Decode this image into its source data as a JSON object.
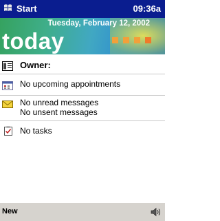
{
  "titlebar": {
    "start_label": "Start",
    "clock": "09:36a",
    "start_icon": "windows-flag-icon"
  },
  "banner": {
    "date": "Tuesday, February 12, 2002",
    "title": "today"
  },
  "items": {
    "owner": {
      "label": "Owner:",
      "icon": "owner-card-icon"
    },
    "appointments": {
      "label": "No upcoming appointments",
      "icon": "calendar-icon"
    },
    "messages": {
      "line1": "No unread messages",
      "line2": "No unsent messages",
      "icon": "envelope-icon"
    },
    "tasks": {
      "label": "No tasks",
      "icon": "task-checkbox-icon"
    }
  },
  "cmdbar": {
    "new_label": "New",
    "speaker_icon": "speaker-icon"
  },
  "colors": {
    "titlebar": "#0a1d8f",
    "command_bar": "#d6d3ce",
    "accent_squares": "#f2a03a"
  }
}
